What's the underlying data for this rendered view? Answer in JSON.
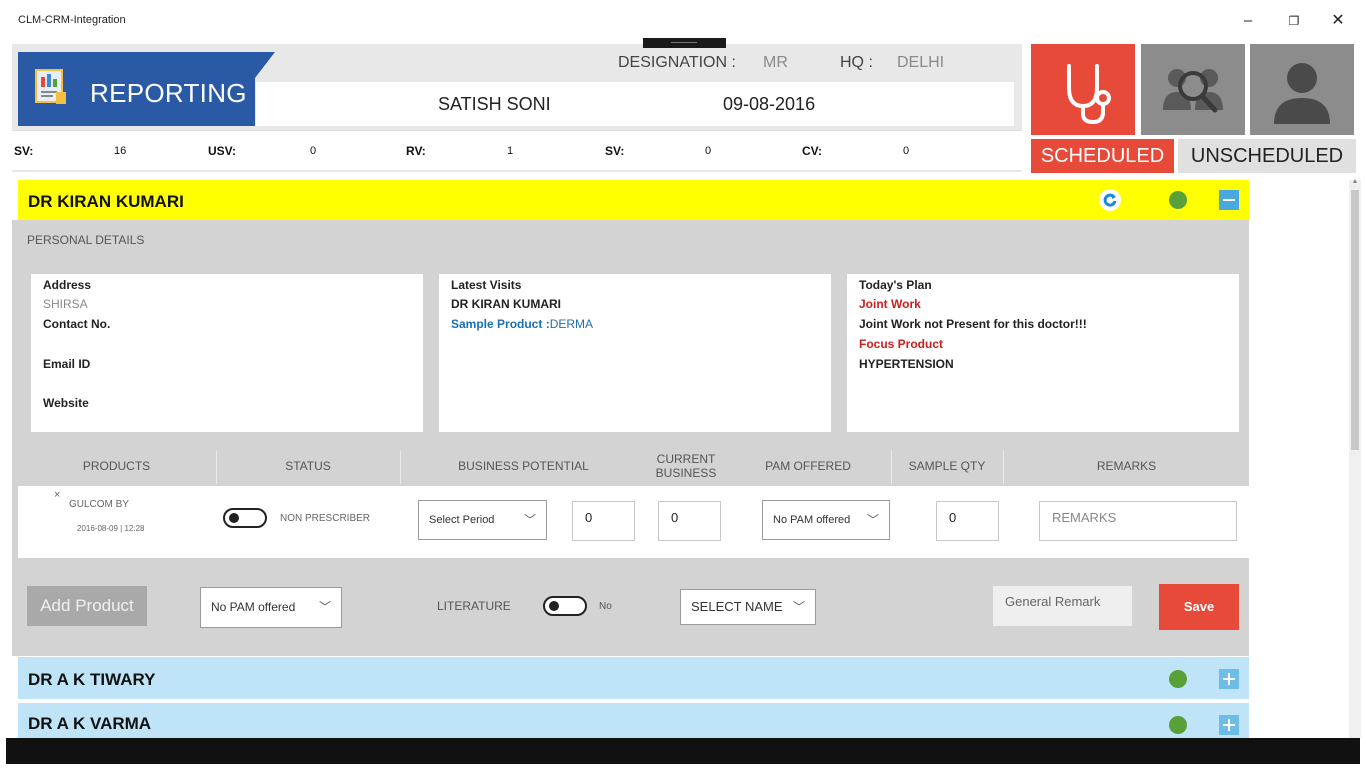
{
  "window": {
    "title": "CLM-CRM-Integration",
    "minimize_glyph": "–",
    "maximize_glyph": "❐",
    "close_glyph": "✕"
  },
  "header": {
    "section_title": "REPORTING",
    "designation_label": "DESIGNATION :",
    "designation_value": "MR",
    "hq_label": "HQ :",
    "hq_value": "DELHI",
    "user_name": "SATISH SONI",
    "date": "09-08-2016",
    "stats": [
      {
        "label": "SV:",
        "value": "16"
      },
      {
        "label": "USV:",
        "value": "0"
      },
      {
        "label": "RV:",
        "value": "1"
      },
      {
        "label": "SV:",
        "value": "0"
      },
      {
        "label": "CV:",
        "value": "0"
      }
    ]
  },
  "tiles": {
    "icons": [
      "stethoscope-icon",
      "team-search-icon",
      "user-icon"
    ],
    "scheduled_label": "SCHEDULED",
    "unscheduled_label": "UNSCHEDULED"
  },
  "doctor": {
    "name": "DR  KIRAN KUMARI",
    "section_label": "PERSONAL DETAILS",
    "address_label": "Address",
    "address_value": "SHIRSA",
    "contact_label": "Contact No.",
    "email_label": "Email ID",
    "website_label": "Website",
    "latest_visits_label": "Latest Visits",
    "latest_visit_doctor": "DR  KIRAN KUMARI",
    "sample_product_label": "Sample Product :",
    "sample_product_value": "DERMA",
    "todays_plan_label": "Today's Plan",
    "joint_work_label": "Joint Work",
    "joint_work_value": "Joint Work not Present for this doctor!!!",
    "focus_product_label": "Focus Product",
    "focus_product_value": "HYPERTENSION"
  },
  "table": {
    "headers": {
      "products": "PRODUCTS",
      "status": "STATUS",
      "business_potential": "BUSINESS POTENTIAL",
      "current_business_1": "CURRENT",
      "current_business_2": "BUSINESS",
      "pam_offered": "PAM OFFERED",
      "sample_qty": "SAMPLE QTY",
      "remarks": "REMARKS"
    },
    "row": {
      "remove_glyph": "×",
      "product": "GULCOM BY",
      "timestamp": "2016-08-09 | 12:28",
      "status": "NON PRESCRIBER",
      "period_value": "Select Period",
      "potential_value": "0",
      "current_value": "0",
      "pam_value": "No PAM offered",
      "sample_qty_value": "0",
      "remarks_placeholder": "REMARKS"
    }
  },
  "actions": {
    "add_product": "Add Product",
    "pam_select": "No PAM offered",
    "literature_label": "LITERATURE",
    "literature_state": "No",
    "select_name": "SELECT NAME",
    "general_remark": "General Remark",
    "save": "Save",
    "chevron_glyph": "﹀"
  },
  "other_doctors": [
    {
      "name": "DR A K TIWARY"
    },
    {
      "name": "DR A K VARMA"
    }
  ],
  "colors": {
    "accent_red": "#e84a3a",
    "reporting_blue": "#2a5aa6",
    "active_doctor_bg": "#ffff00",
    "collapsed_doctor_bg": "#bfe4f7",
    "status_green": "#5aa03a"
  }
}
